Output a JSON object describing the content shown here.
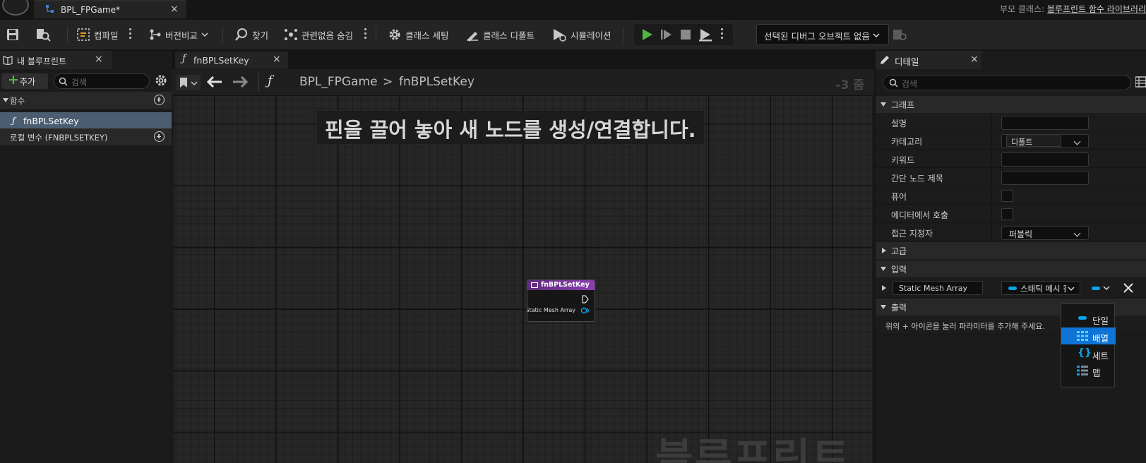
{
  "titlebar": {
    "tab_label": "BPL_FPGame*",
    "tab_close": "×",
    "parent_prefix": "부모 클래스:",
    "parent_link": "블루프린트 함수 라이브러리"
  },
  "toolbar": {
    "compile": "컴파일",
    "diff": "버전비교",
    "find": "찾기",
    "hide_unrelated": "관련없음 숨김",
    "class_settings": "클래스 세팅",
    "class_defaults": "클래스 디폴트",
    "simulation": "시뮬레이션",
    "debug_object": "선택된 디버그 오브젝트 없음"
  },
  "left_panel": {
    "title": "내 블루프린트",
    "close": "×",
    "add_label": "추가",
    "search_placeholder": "검색",
    "functions_header": "함수",
    "function_item": "fnBPLSetKey",
    "local_vars_header": "로컬 변수 (FNBPLSETKEY)"
  },
  "graph": {
    "tab_label": "fnBPLSetKey",
    "tab_close": "×",
    "breadcrumb_root": "BPL_FPGame",
    "breadcrumb_sep": ">",
    "breadcrumb_leaf": "fnBPLSetKey",
    "zoom": "-3 줌",
    "hint": "핀을 끌어 놓아 새 노드를 생성/연결합니다.",
    "watermark": "블루프린트",
    "node_title": "fnBPLSetKey",
    "node_pin": "Static Mesh Array"
  },
  "details": {
    "title": "디테일",
    "close": "×",
    "search_placeholder": "검색",
    "section_graph": "그래프",
    "prop_description": "설명",
    "prop_category": "카테고리",
    "category_value": "디폴트",
    "prop_keywords": "키워드",
    "prop_compact_title": "간단 노드 제목",
    "prop_pure": "퓨어",
    "prop_call_in_editor": "에디터에서 호출",
    "prop_access": "접근 지정자",
    "access_value": "퍼블릭",
    "section_advanced": "고급",
    "section_inputs": "입력",
    "input_name": "Static Mesh Array",
    "input_type": "스태틱 메시 컴포넌트",
    "section_outputs": "출력",
    "outputs_hint": "위의 + 아이콘을 눌러 파라미터를 추가해 주세요."
  },
  "type_menu": {
    "items": [
      "단일",
      "배열",
      "세트",
      "맵"
    ],
    "selected": "배열"
  },
  "colors": {
    "accent_blue": "#0e74d6",
    "pin_blue": "#0ba4ea",
    "play_green": "#4fb83f",
    "node_header": "#8a3eb0"
  }
}
